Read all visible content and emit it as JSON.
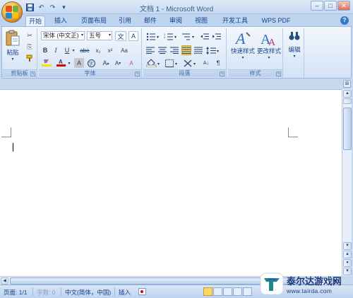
{
  "window": {
    "title": "文档 1 - Microsoft Word",
    "minimize_glyph": "–",
    "maximize_glyph": "□",
    "close_glyph": "✕"
  },
  "quick_access": {
    "save_icon": "save-icon",
    "undo_icon": "undo-icon",
    "redo_icon": "redo-icon",
    "customize_icon": "customize-qat-icon"
  },
  "tabs": [
    {
      "label": "开始",
      "active": true
    },
    {
      "label": "插入"
    },
    {
      "label": "页面布局"
    },
    {
      "label": "引用"
    },
    {
      "label": "邮件"
    },
    {
      "label": "审阅"
    },
    {
      "label": "视图"
    },
    {
      "label": "开发工具"
    },
    {
      "label": "WPS PDF"
    }
  ],
  "help_label": "?",
  "ribbon": {
    "clipboard": {
      "label": "剪贴板",
      "paste_label": "粘贴",
      "cut_glyph": "✂",
      "copy_glyph": "⎘",
      "format_painter_glyph": "🖌"
    },
    "font": {
      "label": "字体",
      "font_name": "宋体 (中文正)",
      "font_size": "五号",
      "bold": "B",
      "italic": "I",
      "underline": "U",
      "strikethrough": "abe",
      "subscript": "x₂",
      "superscript": "x²",
      "grow": "A",
      "shrink": "A",
      "clear_format": "A",
      "change_case": "Aa",
      "char_shading": "A",
      "enclose_char": "字",
      "phonetic": "文",
      "char_border": "A"
    },
    "paragraph": {
      "label": "段落",
      "sort_glyph": "A↓",
      "show_marks": "¶"
    },
    "styles": {
      "label": "样式",
      "quick_styles": "快速样式",
      "change_styles": "更改样式"
    },
    "editing": {
      "label": "编辑",
      "find_glyph": "🔍"
    }
  },
  "status_bar": {
    "page": "页面: 1/1",
    "words": "字数: 0",
    "language": "中文(简体，中国)",
    "insert_mode": "插入"
  },
  "watermark": {
    "title": "泰尔达游戏网",
    "url": "www.tairda.com"
  },
  "colors": {
    "accent": "#15428b",
    "ribbon_bg": "#dfeaf8",
    "highlight_yellow": "#f2e400",
    "font_red": "#d40000",
    "watermark_blue": "#1d3c7a"
  }
}
